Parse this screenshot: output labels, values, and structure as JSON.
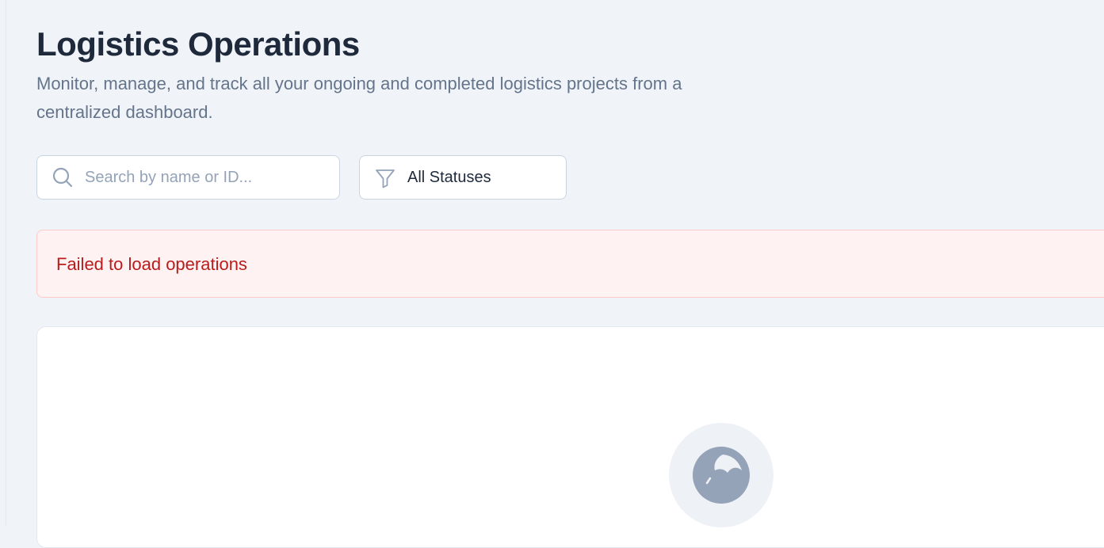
{
  "header": {
    "title": "Logistics Operations",
    "subtitle": "Monitor, manage, and track all your ongoing and completed logistics projects from a centralized dashboard."
  },
  "filters": {
    "search": {
      "placeholder": "Search by name or ID...",
      "value": "",
      "icon": "search-icon"
    },
    "status": {
      "selected": "All Statuses",
      "icon": "filter-icon"
    }
  },
  "error": {
    "message": "Failed to load operations"
  },
  "content": {
    "loader_icon": "globe-icon"
  },
  "colors": {
    "background": "#f0f4f8",
    "title": "#1e293b",
    "subtitle": "#64748b",
    "error_bg": "#fef2f2",
    "error_border": "#fecaca",
    "error_text": "#b91c1c",
    "icon_muted": "#94a3b8"
  }
}
